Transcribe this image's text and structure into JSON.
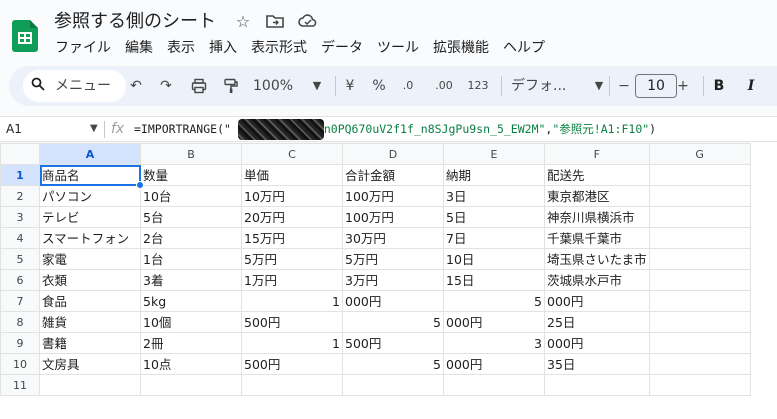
{
  "doc": {
    "title": "参照する側のシート",
    "star_icon": "star-icon",
    "move_icon": "move-to-folder-icon",
    "cloud_icon": "cloud-saved-icon"
  },
  "menu": [
    "ファイル",
    "編集",
    "表示",
    "挿入",
    "表示形式",
    "データ",
    "ツール",
    "拡張機能",
    "ヘルプ"
  ],
  "toolbar": {
    "search_label": "メニュー",
    "zoom": "100%",
    "currency": "¥",
    "percent": "%",
    "dec_decrease": ".0",
    "dec_increase": ".00",
    "number_format": "123",
    "font": "デフォ...",
    "font_size": "10",
    "minus": "−",
    "plus": "+",
    "bold": "B",
    "italic": "I"
  },
  "formula_bar": {
    "cell_ref": "A1",
    "fx": "fx",
    "formula_prefix": "=IMPORTRANGE(\"",
    "formula_key": "yn0PQ670uV2f1f_n8SJgPu9sn_5_EW2M\"",
    "formula_sep": ",",
    "formula_range": "\"参照元!A1:F10\"",
    "formula_suffix": ")"
  },
  "sheet": {
    "columns": [
      "A",
      "B",
      "C",
      "D",
      "E",
      "F",
      "G"
    ],
    "rows": [
      {
        "n": "1",
        "cells": [
          "商品名",
          "数量",
          "単価",
          "合計金額",
          "納期",
          "配送先",
          ""
        ]
      },
      {
        "n": "2",
        "cells": [
          "パソコン",
          "10台",
          "10万円",
          "100万円",
          "3日",
          "東京都港区",
          ""
        ]
      },
      {
        "n": "3",
        "cells": [
          "テレビ",
          "5台",
          "20万円",
          "100万円",
          "5日",
          "神奈川県横浜市",
          ""
        ]
      },
      {
        "n": "4",
        "cells": [
          "スマートフォン",
          "2台",
          "15万円",
          "30万円",
          "7日",
          "千葉県千葉市",
          ""
        ]
      },
      {
        "n": "5",
        "cells": [
          "家電",
          "1台",
          "5万円",
          "5万円",
          "10日",
          "埼玉県さいたま市",
          ""
        ]
      },
      {
        "n": "6",
        "cells": [
          "衣類",
          "3着",
          "1万円",
          "3万円",
          "15日",
          "茨城県水戸市",
          ""
        ]
      },
      {
        "n": "7",
        "cells": [
          "食品",
          "5kg",
          "1",
          "000円",
          "5",
          "000円",
          ""
        ]
      },
      {
        "n": "8",
        "cells": [
          "雑貨",
          "10個",
          "500円",
          "5",
          "000円",
          "25日",
          ""
        ]
      },
      {
        "n": "9",
        "cells": [
          "書籍",
          "2冊",
          "1",
          "500円",
          "3",
          "000円",
          ""
        ]
      },
      {
        "n": "10",
        "cells": [
          "文房具",
          "10点",
          "500円",
          "5",
          "000円",
          "35日",
          ""
        ]
      },
      {
        "n": "11",
        "cells": [
          "",
          "",
          "",
          "",
          "",
          "",
          ""
        ]
      }
    ],
    "numeric_cells": [
      [
        6,
        2
      ],
      [
        6,
        4
      ],
      [
        7,
        3
      ],
      [
        8,
        2
      ],
      [
        8,
        4
      ],
      [
        9,
        3
      ]
    ]
  }
}
